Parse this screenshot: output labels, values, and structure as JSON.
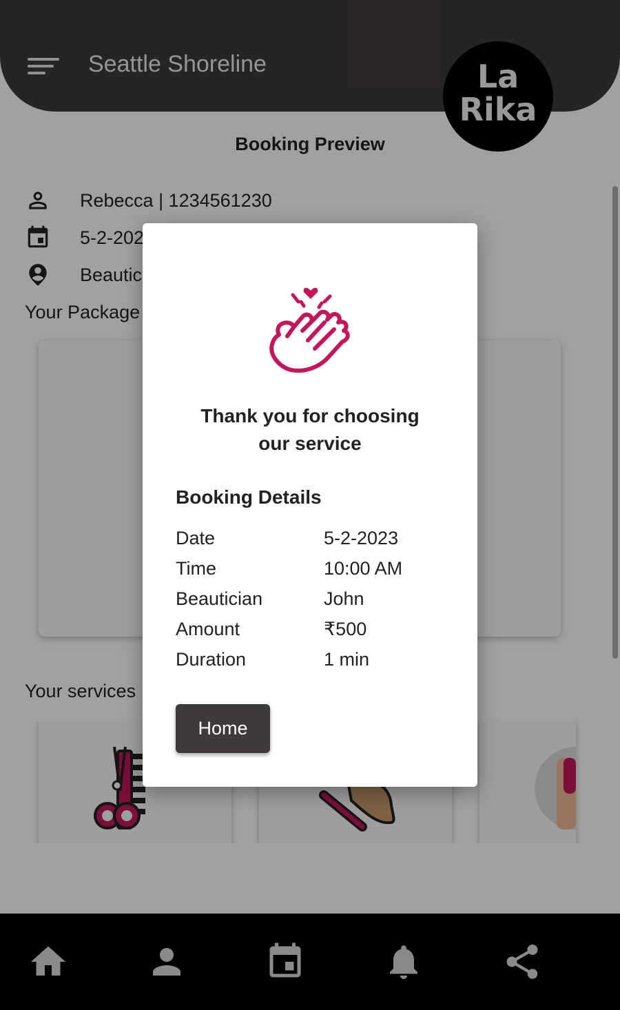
{
  "header": {
    "title": "Seattle Shoreline",
    "logo_line1": "La",
    "logo_line2": "Rika"
  },
  "page": {
    "heading": "Booking Preview",
    "customer": "Rebecca | 1234561230",
    "date_partial": "5-2-202",
    "beautician_partial": "Beautic",
    "package_label": "Your Package",
    "services_label": "Your services"
  },
  "dialog": {
    "thank_you_line1": "Thank you for choosing",
    "thank_you_line2": "our service",
    "details_heading": "Booking Details",
    "details": [
      {
        "label": "Date",
        "value": "5-2-2023"
      },
      {
        "label": "Time",
        "value": "10:00 AM"
      },
      {
        "label": "Beautician",
        "value": "John"
      },
      {
        "label": "Amount",
        "value": "₹500"
      },
      {
        "label": "Duration",
        "value": "1 min"
      }
    ],
    "home_button": "Home"
  },
  "bottom_nav": [
    {
      "icon": "home-icon"
    },
    {
      "icon": "person-icon"
    },
    {
      "icon": "calendar-icon"
    },
    {
      "icon": "bell-icon"
    },
    {
      "icon": "share-icon"
    }
  ],
  "colors": {
    "appbar": "#3f393e",
    "accent": "#c2185b",
    "nav_background": "#000000",
    "dialog_button": "#3f393e"
  }
}
